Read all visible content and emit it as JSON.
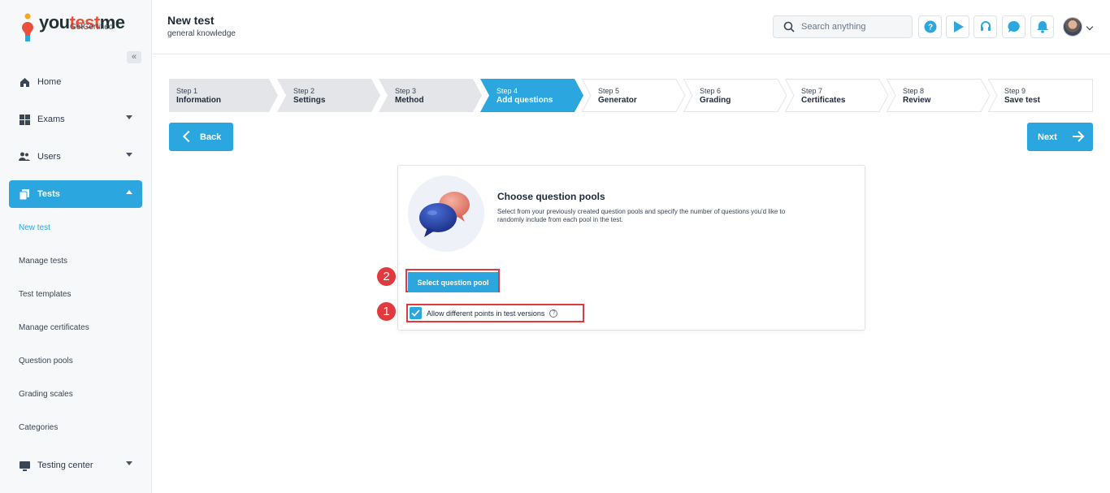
{
  "brand": {
    "name_part1": "you",
    "name_part2": "test",
    "name_part3": "me",
    "tagline": "GetCertified"
  },
  "sidebar": {
    "collapse_icon": "double-chevron-left-icon",
    "items": [
      {
        "label": "Home",
        "icon": "home-icon"
      },
      {
        "label": "Exams",
        "icon": "exams-icon"
      },
      {
        "label": "Users",
        "icon": "users-icon"
      },
      {
        "label": "Tests",
        "icon": "tests-icon"
      },
      {
        "label": "Testing center",
        "icon": "testing-center-icon"
      }
    ],
    "sub_items": [
      "New test",
      "Manage tests",
      "Test templates",
      "Manage certificates",
      "Question pools",
      "Grading scales",
      "Categories"
    ]
  },
  "header": {
    "title": "New test",
    "subtitle": "general knowledge",
    "search_placeholder": "Search anything",
    "icons": [
      "help-icon",
      "play-icon",
      "support-icon",
      "chat-icon",
      "bell-icon"
    ]
  },
  "steps": [
    {
      "num": "Step 1",
      "name": "Information",
      "state": "done"
    },
    {
      "num": "Step 2",
      "name": "Settings",
      "state": "done"
    },
    {
      "num": "Step 3",
      "name": "Method",
      "state": "done"
    },
    {
      "num": "Step 4",
      "name": "Add questions",
      "state": "current"
    },
    {
      "num": "Step 5",
      "name": "Generator",
      "state": "todo"
    },
    {
      "num": "Step 6",
      "name": "Grading",
      "state": "todo"
    },
    {
      "num": "Step 7",
      "name": "Certificates",
      "state": "todo"
    },
    {
      "num": "Step 8",
      "name": "Review",
      "state": "todo"
    },
    {
      "num": "Step 9",
      "name": "Save test",
      "state": "todo"
    }
  ],
  "nav": {
    "back": "Back",
    "next": "Next"
  },
  "card": {
    "title": "Choose question pools",
    "description": "Select from your previously created question pools and specify the number of questions you'd like to randomly include from each pool in the test.",
    "select_button": "Select question pool",
    "checkbox_label": "Allow different points in test versions",
    "checkbox_checked": true,
    "help_glyph": "?"
  },
  "markers": [
    "1",
    "2"
  ],
  "colors": {
    "accent": "#2ba6df",
    "highlight": "#e0393e",
    "step_done": "#e3e5e9",
    "brand_accent": "#e94f3a"
  }
}
